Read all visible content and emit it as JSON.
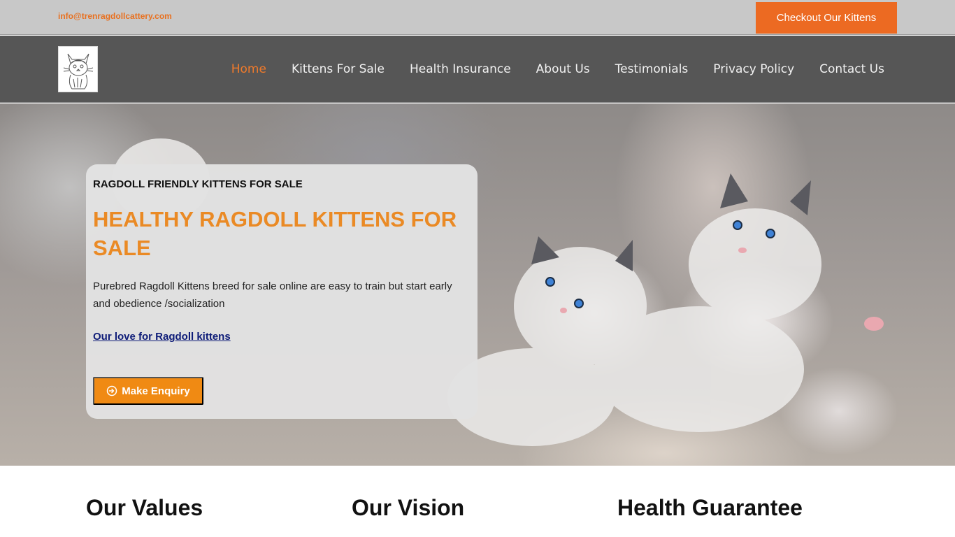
{
  "topbar": {
    "email": "info@trenragdollcattery.com",
    "cta_label": "Checkout Our Kittens"
  },
  "nav": {
    "items": [
      {
        "label": "Home",
        "active": true
      },
      {
        "label": "Kittens For Sale",
        "active": false
      },
      {
        "label": "Health Insurance",
        "active": false
      },
      {
        "label": "About Us",
        "active": false
      },
      {
        "label": "Testimonials",
        "active": false
      },
      {
        "label": "Privacy Policy",
        "active": false
      },
      {
        "label": "Contact Us",
        "active": false
      }
    ]
  },
  "hero": {
    "eyebrow": "RAGDOLL FRIENDLY KITTENS FOR SALE",
    "headline": "HEALTHY RAGDOLL KITTENS FOR SALE",
    "description": "Purebred Ragdoll Kittens breed for sale online are easy to train but start early and obedience /socialization",
    "love_link": "Our love for Ragdoll kittens",
    "button_label": "Make Enquiry"
  },
  "sections": {
    "values_title": "Our Values",
    "vision_title": "Our Vision",
    "guarantee_title": "Health Guarantee"
  },
  "colors": {
    "accent_orange": "#ec6a22",
    "headline_orange": "#ea8a25",
    "button_orange": "#f08a13",
    "link_navy": "#0e1c78",
    "topbar_gray": "#c8c8c8",
    "navbar_gray": "#565656"
  },
  "icons": {
    "logo": "cat-sketch-logo",
    "enquiry": "arrow-circle-right-icon"
  }
}
